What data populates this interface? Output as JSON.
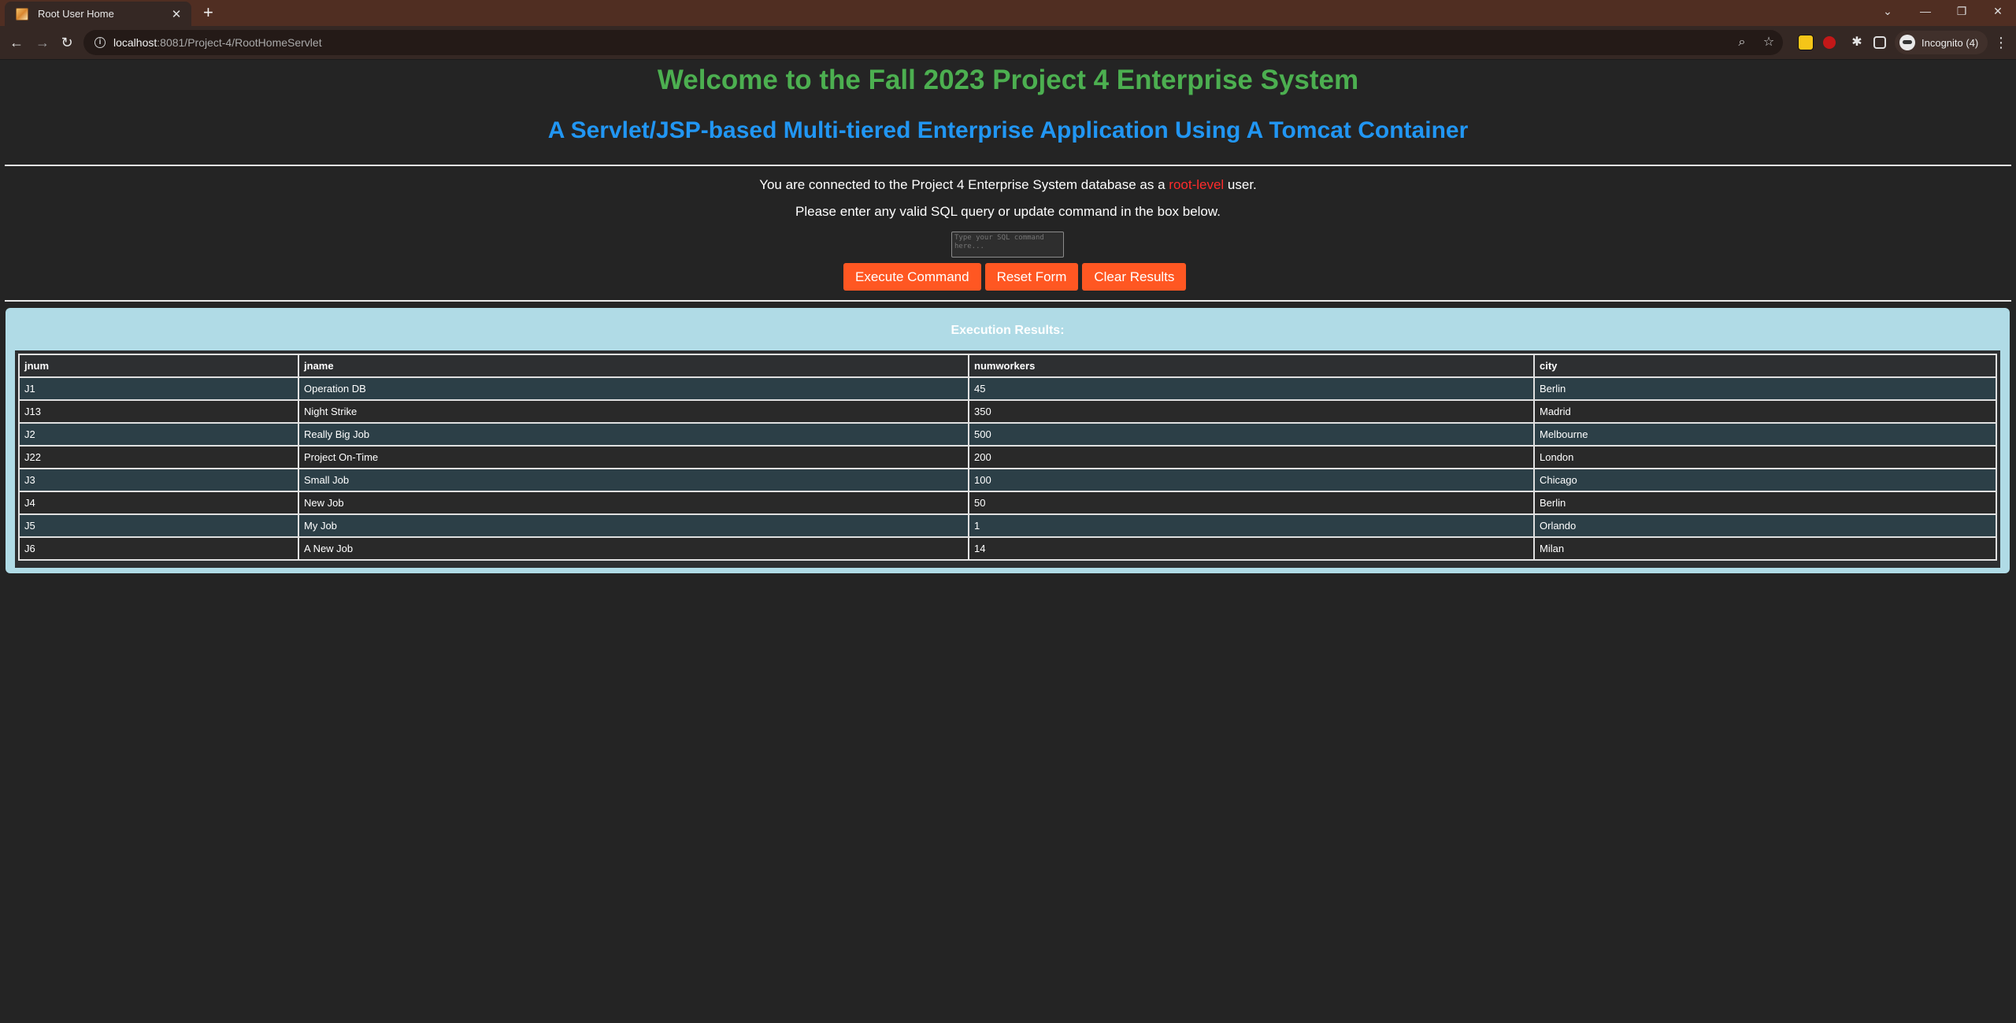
{
  "browser": {
    "tab_title": "Root User Home",
    "url_host": "localhost",
    "url_rest": ":8081/Project-4/RootHomeServlet",
    "profile_label": "Incognito (4)"
  },
  "page": {
    "title": "Welcome to the Fall 2023 Project 4 Enterprise System",
    "subtitle": "A Servlet/JSP-based Multi-tiered Enterprise Application Using A Tomcat Container",
    "connected_prefix": "You are connected to the Project 4 Enterprise System database as a ",
    "connected_role": "root-level",
    "connected_suffix": " user.",
    "instructions": "Please enter any valid SQL query or update command in the box below.",
    "sql_placeholder": "Type your SQL command here...",
    "buttons": {
      "execute": "Execute Command",
      "reset": "Reset Form",
      "clear": "Clear Results"
    },
    "results_title": "Execution Results:"
  },
  "colors": {
    "title": "#4caf50",
    "subtitle": "#2196f3",
    "button": "#ff5722",
    "role": "#ff2b2b",
    "results_panel": "#b0dbe6"
  },
  "table": {
    "headers": [
      "jnum",
      "jname",
      "numworkers",
      "city"
    ],
    "rows": [
      [
        "J1",
        "Operation DB",
        "45",
        "Berlin"
      ],
      [
        "J13",
        "Night Strike",
        "350",
        "Madrid"
      ],
      [
        "J2",
        "Really Big Job",
        "500",
        "Melbourne"
      ],
      [
        "J22",
        "Project On-Time",
        "200",
        "London"
      ],
      [
        "J3",
        "Small Job",
        "100",
        "Chicago"
      ],
      [
        "J4",
        "New Job",
        "50",
        "Berlin"
      ],
      [
        "J5",
        "My Job",
        "1",
        "Orlando"
      ],
      [
        "J6",
        "A New Job",
        "14",
        "Milan"
      ]
    ]
  }
}
